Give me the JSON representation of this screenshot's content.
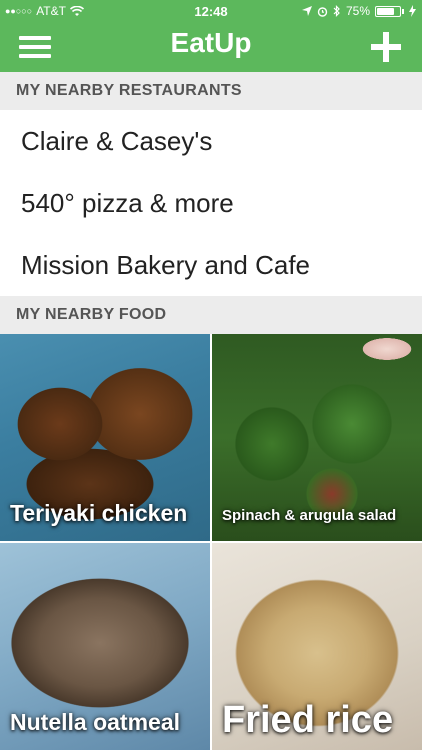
{
  "status_bar": {
    "signal": "●●○○○",
    "carrier": "AT&T",
    "time": "12:48",
    "battery_percent": "75%",
    "battery_level": 0.75
  },
  "nav": {
    "title": "EatUp",
    "menu_icon": "hamburger-menu-icon",
    "add_icon": "plus-icon"
  },
  "restaurants": {
    "header": "MY NEARBY RESTAURANTS",
    "items": [
      "Claire & Casey's",
      "540° pizza & more",
      "Mission Bakery and Cafe"
    ]
  },
  "food": {
    "header": "MY NEARBY FOOD",
    "items": [
      "Teriyaki chicken",
      "Spinach & arugula salad",
      "Nutella oatmeal",
      "Fried rice"
    ]
  },
  "colors": {
    "brand_green": "#5cb85c",
    "section_bg": "#ececec"
  }
}
